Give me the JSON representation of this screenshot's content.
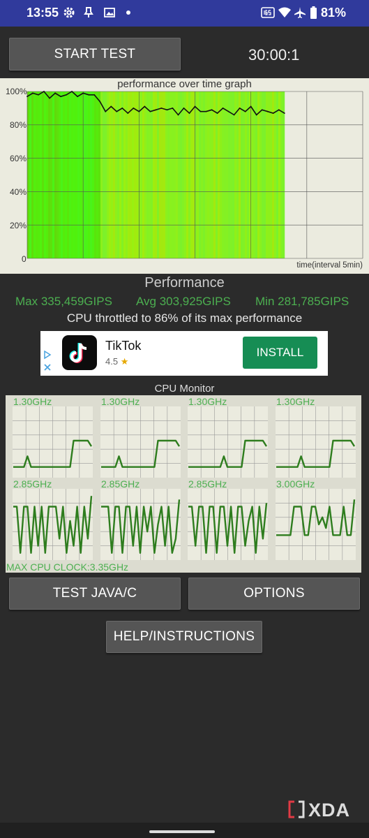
{
  "status_bar": {
    "time": "13:55",
    "battery": "81%",
    "icons": [
      "gear-icon",
      "pin-icon",
      "image-icon",
      "dot-icon",
      "refresh-rate-icon",
      "wifi-icon",
      "airplane-icon",
      "battery-icon"
    ]
  },
  "controls": {
    "start_test": "START TEST",
    "timer": "30:00:1",
    "test_java_c": "TEST JAVA/C",
    "options": "OPTIONS",
    "help": "HELP/INSTRUCTIONS"
  },
  "chart_data": {
    "type": "area",
    "title": "performance over time graph",
    "xlabel": "time(interval 5min)",
    "ylabel": "",
    "y_ticks": [
      "100%",
      "80%",
      "60%",
      "40%",
      "20%",
      "0"
    ],
    "ylim": [
      0,
      100
    ],
    "x_units": "minutes",
    "xlim": [
      0,
      30
    ],
    "grid": true,
    "series": [
      {
        "x": [
          0,
          0.5,
          1,
          1.5,
          2,
          2.5,
          3,
          3.5,
          4,
          4.5,
          5,
          5.5,
          6,
          6.5,
          7,
          7.5,
          8,
          8.5,
          9,
          9.5,
          10,
          10.5,
          11,
          11.5,
          12,
          12.5,
          13,
          13.5,
          14,
          14.5,
          15,
          15.5,
          16,
          16.5,
          17,
          17.5,
          18,
          18.5,
          19,
          19.5,
          20,
          20.5,
          21,
          21.5,
          22,
          22.5,
          23
        ],
        "values": [
          97,
          99,
          98,
          100,
          96,
          99,
          97,
          98,
          100,
          97,
          99,
          98,
          98,
          94,
          88,
          91,
          88,
          90,
          87,
          90,
          88,
          91,
          88,
          89,
          90,
          89,
          90,
          86,
          90,
          87,
          91,
          88,
          88,
          89,
          87,
          90,
          88,
          86,
          90,
          88,
          91,
          86,
          89,
          88,
          87,
          89,
          87
        ]
      }
    ]
  },
  "stats": {
    "heading": "Performance",
    "max": "Max 335,459GIPS",
    "avg": "Avg 303,925GIPS",
    "min": "Min 281,785GIPS",
    "throttle": "CPU throttled to 86% of its max performance"
  },
  "ad": {
    "name": "TikTok",
    "rating": "4.5",
    "install": "INSTALL"
  },
  "cpu_monitor": {
    "title": "CPU Monitor",
    "max_clock": "MAX CPU CLOCK:3.35GHz",
    "cores": [
      {
        "freq": "1.30GHz",
        "levels": [
          0.15,
          0.15,
          0.15,
          0.15,
          0.3,
          0.15,
          0.15,
          0.15,
          0.15,
          0.15,
          0.15,
          0.15,
          0.15,
          0.15,
          0.15,
          0.15,
          0.15,
          0.52,
          0.52,
          0.52,
          0.52,
          0.52,
          0.44
        ]
      },
      {
        "freq": "1.30GHz",
        "levels": [
          0.15,
          0.15,
          0.15,
          0.15,
          0.15,
          0.3,
          0.15,
          0.15,
          0.15,
          0.15,
          0.15,
          0.15,
          0.15,
          0.15,
          0.15,
          0.15,
          0.52,
          0.52,
          0.52,
          0.52,
          0.52,
          0.52,
          0.44
        ]
      },
      {
        "freq": "1.30GHz",
        "levels": [
          0.15,
          0.15,
          0.15,
          0.15,
          0.15,
          0.15,
          0.15,
          0.15,
          0.15,
          0.15,
          0.3,
          0.15,
          0.15,
          0.15,
          0.15,
          0.15,
          0.52,
          0.52,
          0.52,
          0.52,
          0.52,
          0.52,
          0.44
        ]
      },
      {
        "freq": "1.30GHz",
        "levels": [
          0.15,
          0.15,
          0.15,
          0.15,
          0.15,
          0.15,
          0.15,
          0.3,
          0.15,
          0.15,
          0.15,
          0.15,
          0.15,
          0.15,
          0.15,
          0.15,
          0.52,
          0.52,
          0.52,
          0.52,
          0.52,
          0.52,
          0.44
        ]
      },
      {
        "freq": "2.85GHz",
        "levels": [
          0.75,
          0.75,
          0.1,
          0.75,
          0.75,
          0.1,
          0.75,
          0.2,
          0.75,
          0.1,
          0.75,
          0.75,
          0.75,
          0.3,
          0.75,
          0.1,
          0.55,
          0.2,
          0.75,
          0.1,
          0.75,
          0.3,
          0.9
        ]
      },
      {
        "freq": "2.85GHz",
        "levels": [
          0.75,
          0.75,
          0.75,
          0.1,
          0.75,
          0.75,
          0.1,
          0.75,
          0.75,
          0.2,
          0.75,
          0.1,
          0.75,
          0.4,
          0.75,
          0.1,
          0.5,
          0.75,
          0.2,
          0.75,
          0.1,
          0.3,
          0.85
        ]
      },
      {
        "freq": "2.85GHz",
        "levels": [
          0.75,
          0.75,
          0.2,
          0.75,
          0.75,
          0.1,
          0.75,
          0.75,
          0.1,
          0.75,
          0.75,
          0.2,
          0.75,
          0.1,
          0.75,
          0.75,
          0.2,
          0.55,
          0.75,
          0.1,
          0.75,
          0.3,
          0.8
        ]
      },
      {
        "freq": "3.00GHz",
        "levels": [
          0.35,
          0.35,
          0.35,
          0.35,
          0.35,
          0.75,
          0.75,
          0.75,
          0.35,
          0.35,
          0.75,
          0.75,
          0.5,
          0.6,
          0.45,
          0.75,
          0.35,
          0.35,
          0.35,
          0.75,
          0.35,
          0.35,
          0.85
        ]
      }
    ]
  },
  "watermark": {
    "text": "XDA"
  }
}
